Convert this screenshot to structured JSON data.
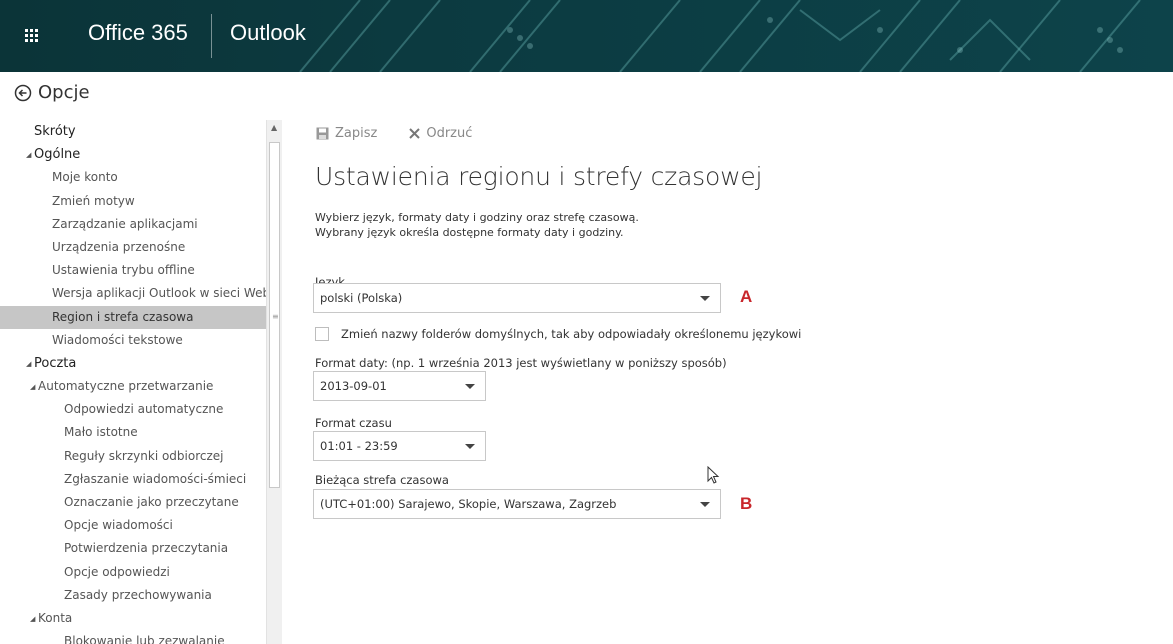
{
  "topbar": {
    "brand": "Office 365",
    "app": "Outlook"
  },
  "header": {
    "title": "Opcje"
  },
  "nav": {
    "items": [
      {
        "label": "Skróty",
        "level": 1,
        "expandable": false,
        "selected": false
      },
      {
        "label": "Ogólne",
        "level": 1,
        "expandable": true,
        "selected": false
      },
      {
        "label": "Moje konto",
        "level": 2,
        "selected": false
      },
      {
        "label": "Zmień motyw",
        "level": 2,
        "selected": false
      },
      {
        "label": "Zarządzanie aplikacjami",
        "level": 2,
        "selected": false
      },
      {
        "label": "Urządzenia przenośne",
        "level": 2,
        "selected": false
      },
      {
        "label": "Ustawienia trybu offline",
        "level": 2,
        "selected": false
      },
      {
        "label": "Wersja aplikacji Outlook w sieci Web",
        "level": 2,
        "selected": false
      },
      {
        "label": "Region i strefa czasowa",
        "level": 2,
        "selected": true
      },
      {
        "label": "Wiadomości tekstowe",
        "level": 2,
        "selected": false
      },
      {
        "label": "Poczta",
        "level": 1,
        "expandable": true,
        "selected": false
      },
      {
        "label": "Automatyczne przetwarzanie",
        "level": 2,
        "expandable": true,
        "selected": false
      },
      {
        "label": "Odpowiedzi automatyczne",
        "level": 3,
        "selected": false
      },
      {
        "label": "Mało istotne",
        "level": 3,
        "selected": false
      },
      {
        "label": "Reguły skrzynki odbiorczej",
        "level": 3,
        "selected": false
      },
      {
        "label": "Zgłaszanie wiadomości-śmieci",
        "level": 3,
        "selected": false
      },
      {
        "label": "Oznaczanie jako przeczytane",
        "level": 3,
        "selected": false
      },
      {
        "label": "Opcje wiadomości",
        "level": 3,
        "selected": false
      },
      {
        "label": "Potwierdzenia przeczytania",
        "level": 3,
        "selected": false
      },
      {
        "label": "Opcje odpowiedzi",
        "level": 3,
        "selected": false
      },
      {
        "label": "Zasady przechowywania",
        "level": 3,
        "selected": false
      },
      {
        "label": "Konta",
        "level": 2,
        "expandable": true,
        "selected": false
      },
      {
        "label": "Blokowanie lub zezwalanie",
        "level": 3,
        "selected": false
      }
    ]
  },
  "toolbar": {
    "save_label": "Zapisz",
    "discard_label": "Odrzuć"
  },
  "main": {
    "title": "Ustawienia regionu i strefy czasowej",
    "desc_line1": "Wybierz język, formaty daty i godziny oraz strefę czasową.",
    "desc_line2": "Wybrany język określa dostępne formaty daty i godziny.",
    "language": {
      "label": "Język",
      "value": "polski (Polska)",
      "marker": "A"
    },
    "rename_folders": {
      "label": "Zmień nazwy folderów domyślnych, tak aby odpowiadały określonemu językowi",
      "checked": false
    },
    "date_format": {
      "label": "Format daty: (np. 1 września 2013 jest wyświetlany w poniższy sposób)",
      "value": "2013-09-01"
    },
    "time_format": {
      "label": "Format czasu",
      "value": "01:01 - 23:59"
    },
    "timezone": {
      "label": "Bieżąca strefa czasowa",
      "value": "(UTC+01:00) Sarajewo, Skopie, Warszawa, Zagrzeb",
      "marker": "B"
    }
  },
  "colors": {
    "topbar_bg": "#0a3a3f",
    "selected_nav": "#c6c6c6",
    "marker": "#c8262b"
  },
  "icons": {
    "waffle": "app-launcher-icon",
    "back": "back-arrow-icon",
    "save": "floppy-disk-icon",
    "discard": "x-icon"
  }
}
